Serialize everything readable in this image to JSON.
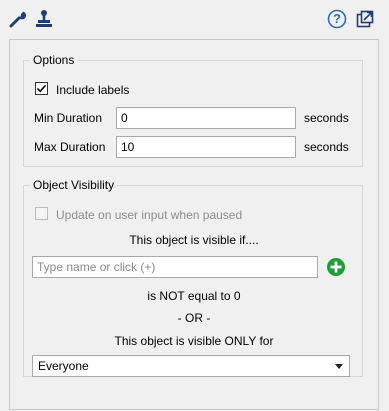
{
  "toolbar": {
    "left_icons": [
      "wrench-icon",
      "stamp-icon"
    ],
    "right_icons": [
      "help-icon",
      "popout-icon"
    ],
    "help_glyph": "?"
  },
  "options": {
    "title": "Options",
    "include_labels": {
      "label": "Include labels",
      "checked": true
    },
    "min_duration": {
      "label": "Min Duration",
      "value": "0",
      "unit": "seconds"
    },
    "max_duration": {
      "label": "Max Duration",
      "value": "10",
      "unit": "seconds"
    }
  },
  "visibility": {
    "title": "Object Visibility",
    "update_on_input": {
      "label": "Update on user input when paused",
      "checked": false,
      "disabled": true
    },
    "visible_if_label": "This object is visible if....",
    "name_input": {
      "placeholder": "Type name or click (+)",
      "value": ""
    },
    "add_icon": "plus-circle-icon",
    "condition_text": "is NOT equal to 0",
    "or_text": "- OR -",
    "visible_only_for_label": "This object is visible ONLY for",
    "audience_select": {
      "value": "Everyone"
    }
  },
  "colors": {
    "accent_blue": "#2b6fb9",
    "add_green": "#1e9c3a",
    "panel_bg": "#f0f0f0",
    "disabled_text": "#8c8c8c"
  }
}
